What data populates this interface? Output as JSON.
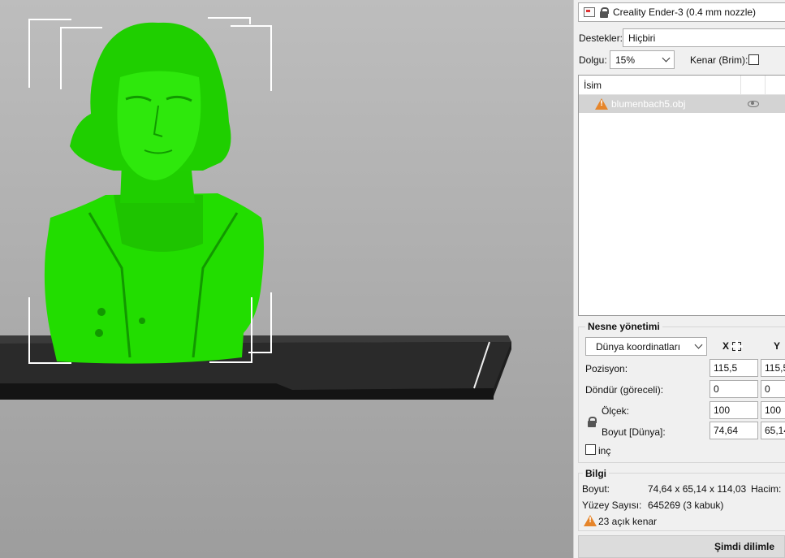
{
  "printer": {
    "name": "Creality Ender-3 (0.4 mm nozzle)"
  },
  "supports": {
    "label": "Destekler:",
    "value": "Hiçbiri"
  },
  "infill": {
    "label": "Dolgu:",
    "value": "15%"
  },
  "brim": {
    "label": "Kenar (Brim):",
    "checked": false
  },
  "object_list": {
    "header": "İsim",
    "objects": [
      {
        "name": "blumenbach5.obj",
        "warning": true,
        "visible": true
      }
    ]
  },
  "object_manipulation": {
    "title": "Nesne yönetimi",
    "coord_system": "Dünya koordinatları",
    "axes": [
      "X",
      "Y"
    ],
    "rows": [
      {
        "label": "Pozisyon:",
        "x": "115,5",
        "y": "115,5"
      },
      {
        "label": "Döndür (göreceli):",
        "x": "0",
        "y": "0"
      },
      {
        "label": "Ölçek:",
        "x": "100",
        "y": "100"
      },
      {
        "label": "Boyut [Dünya]:",
        "x": "74,64",
        "y": "65,14"
      }
    ],
    "inch_label": "inç"
  },
  "info": {
    "title": "Bilgi",
    "size_label": "Boyut:",
    "size_value": "74,64 x 65,14 x 114,03",
    "volume_label": "Hacim:",
    "facets_label": "Yüzey Sayısı:",
    "facets_value": "645269 (3 kabuk)",
    "warning_text": "23 açık kenar"
  },
  "slice_button": "Şimdi dilimle",
  "colors": {
    "model": "#22dd00",
    "bed": "#2b2b2b",
    "viewport_bg": "#b0b0b0"
  }
}
